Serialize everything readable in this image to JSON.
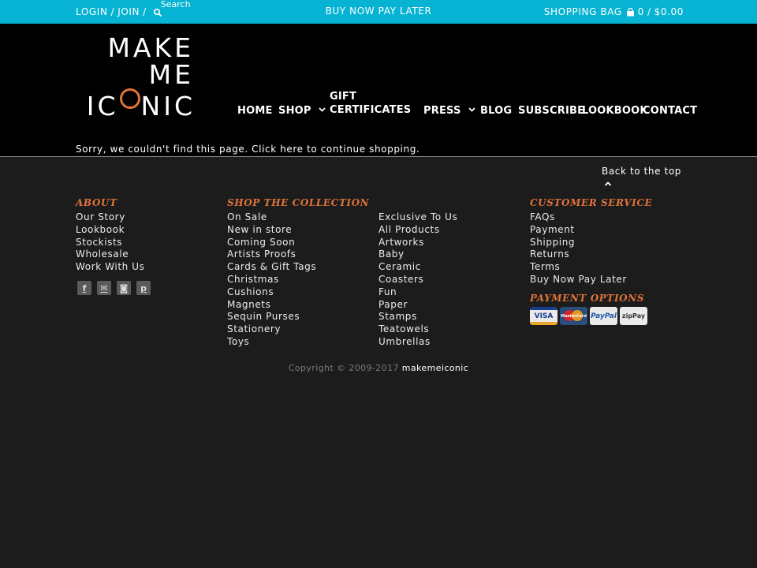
{
  "topbar": {
    "login": "LOGIN",
    "join": "JOIN",
    "sep": "/",
    "search_placeholder": "Search",
    "center_link": "BUY NOW PAY LATER",
    "bag_label": "SHOPPING BAG",
    "bag_count": "0",
    "bag_sep": "/",
    "bag_total": "$0.00"
  },
  "logo": {
    "line1": "MAKE",
    "line2": "ME",
    "line3_a": "IC",
    "line3_b": "NIC"
  },
  "nav": {
    "home": "HOME",
    "shop": "SHOP",
    "gift_1": "GIFT",
    "gift_2": "CERTIFICATES",
    "press": "PRESS",
    "blog": "BLOG",
    "subscribe": "SUBSCRIBE",
    "lookbook": "LOOKBOOK",
    "contact": "CONTACT"
  },
  "notfound": {
    "before": "Sorry, we couldn't find this page. Click ",
    "link": "here",
    "after": " to continue shopping."
  },
  "footer": {
    "back_to_top": "Back to the top",
    "about": {
      "heading": "ABOUT",
      "items": [
        "Our Story",
        "Lookbook",
        "Stockists",
        "Wholesale",
        "Work With Us"
      ]
    },
    "shop": {
      "heading": "SHOP THE COLLECTION",
      "col1": [
        "On Sale",
        "New in store",
        "Coming Soon",
        "Artists Proofs",
        "Cards & Gift Tags",
        "Christmas",
        "Cushions",
        "Magnets",
        "Sequin Purses",
        "Stationery",
        "Toys"
      ],
      "col2": [
        "Exclusive To Us",
        "All Products",
        "Artworks",
        "Baby",
        "Ceramic",
        "Coasters",
        "Fun",
        "Paper",
        "Stamps",
        "Teatowels",
        "Umbrellas"
      ]
    },
    "service": {
      "heading": "CUSTOMER SERVICE",
      "items": [
        "FAQs",
        "Payment",
        "Shipping",
        "Returns",
        "Terms",
        "Buy Now Pay Later"
      ]
    },
    "payment": {
      "heading": "PAYMENT OPTIONS",
      "visa": "VISA",
      "mastercard": "MasterCard",
      "paypal": "PayPal",
      "zippay": "zipPay"
    },
    "social": {
      "facebook": "f",
      "email": "✉",
      "instagram": "◙",
      "pinterest": "p"
    },
    "copyright": "Copyright © 2009-2017",
    "brand_link": "makemeiconic"
  },
  "colors": {
    "topbar": "#07b3d3",
    "header": "#000000",
    "footer": "#1c1c1c",
    "accent": "#e0733a"
  }
}
